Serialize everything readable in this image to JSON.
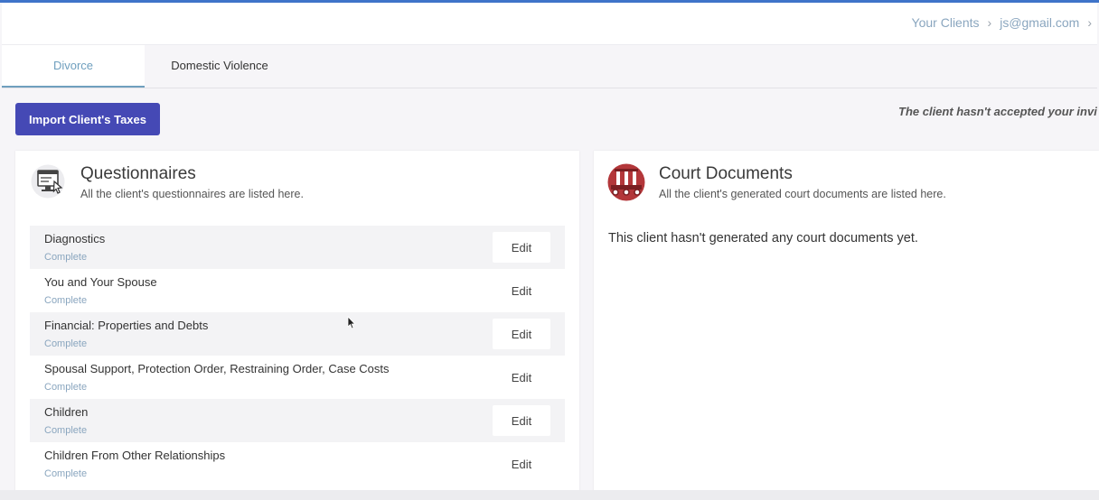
{
  "breadcrumb": {
    "items": [
      "Your Clients",
      "js@gmail.com"
    ]
  },
  "tabs": [
    {
      "label": "Divorce",
      "active": true
    },
    {
      "label": "Domestic Violence",
      "active": false
    }
  ],
  "actions": {
    "import_label": "Import Client's Taxes"
  },
  "notice": "The client hasn't accepted your invi",
  "questionnaires": {
    "title": "Questionnaires",
    "subtitle": "All the client's questionnaires are listed here.",
    "icon": "monitor-pointer-icon",
    "items": [
      {
        "name": "Diagnostics",
        "status": "Complete",
        "action": "Edit"
      },
      {
        "name": "You and Your Spouse",
        "status": "Complete",
        "action": "Edit"
      },
      {
        "name": "Financial: Properties and Debts",
        "status": "Complete",
        "action": "Edit"
      },
      {
        "name": "Spousal Support, Protection Order, Restraining Order, Case Costs",
        "status": "Complete",
        "action": "Edit"
      },
      {
        "name": "Children",
        "status": "Complete",
        "action": "Edit"
      },
      {
        "name": "Children From Other Relationships",
        "status": "Complete",
        "action": "Edit"
      }
    ]
  },
  "court_documents": {
    "title": "Court Documents",
    "subtitle": "All the client's generated court documents are listed here.",
    "icon": "courthouse-icon",
    "empty_message": "This client hasn't generated any court documents yet."
  },
  "colors": {
    "accent": "#4549b5",
    "tab_active": "#6f9fbe",
    "status": "#8aa6bf",
    "court_icon": "#b3373a"
  }
}
